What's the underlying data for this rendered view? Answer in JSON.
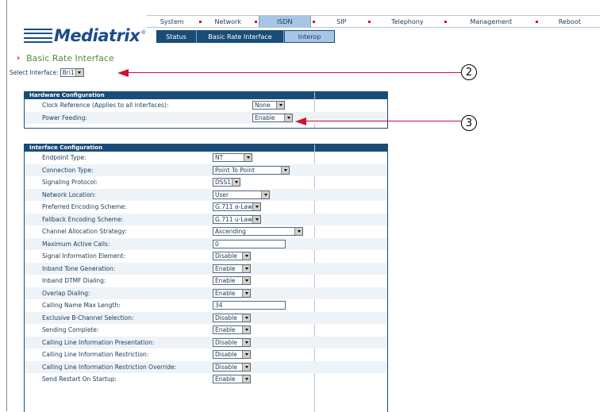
{
  "nav": {
    "items": [
      "System",
      "Network",
      "ISDN",
      "SIP",
      "Telephony",
      "Management",
      "Reboot"
    ],
    "active": "ISDN"
  },
  "subnav": {
    "items": [
      "Status",
      "Basic Rate Interface",
      "Interop"
    ],
    "active": "Interop"
  },
  "logo": {
    "text": "Mediatrix",
    "reg": "®"
  },
  "page_title": "Basic Rate Interface",
  "select_interface": {
    "label": "Select Interface:",
    "value": "Bri1"
  },
  "hardware": {
    "header": "Hardware Configuration",
    "rows": [
      {
        "label": "Clock Reference (Applies to all interfaces):",
        "value": "None"
      },
      {
        "label": "Power Feeding:",
        "value": "Enable"
      }
    ]
  },
  "interface": {
    "header": "Interface Configuration",
    "rows": [
      {
        "label": "Endpoint Type:",
        "value": "NT",
        "kind": "select"
      },
      {
        "label": "Connection Type:",
        "value": "Point To Point",
        "kind": "select"
      },
      {
        "label": "Signaling Protocol:",
        "value": "DSS1",
        "kind": "select"
      },
      {
        "label": "Network Location:",
        "value": "User",
        "kind": "select"
      },
      {
        "label": "Preferred Encoding Scheme:",
        "value": "G.711 a-Law",
        "kind": "select"
      },
      {
        "label": "Fallback Encoding Scheme:",
        "value": "G.711 u-Law",
        "kind": "select"
      },
      {
        "label": "Channel Allocation Strategy:",
        "value": "Ascending",
        "kind": "select"
      },
      {
        "label": "Maximum Active Calls:",
        "value": "0",
        "kind": "text"
      },
      {
        "label": "Signal Information Element:",
        "value": "Disable",
        "kind": "select"
      },
      {
        "label": "Inband Tone Generation:",
        "value": "Enable",
        "kind": "select"
      },
      {
        "label": "Inband DTMF Dialing:",
        "value": "Enable",
        "kind": "select"
      },
      {
        "label": "Overlap Dialing:",
        "value": "Enable",
        "kind": "select"
      },
      {
        "label": "Calling Name Max Length:",
        "value": "34",
        "kind": "text"
      },
      {
        "label": "Exclusive B-Channel Selection:",
        "value": "Disable",
        "kind": "select"
      },
      {
        "label": "Sending Complete:",
        "value": "Enable",
        "kind": "select"
      },
      {
        "label": "Calling Line Information Presentation:",
        "value": "Disable",
        "kind": "select"
      },
      {
        "label": "Calling Line Information Restriction:",
        "value": "Disable",
        "kind": "select"
      },
      {
        "label": "Calling Line Information Restriction Override:",
        "value": "Disable",
        "kind": "select"
      },
      {
        "label": "Send Restart On Startup:",
        "value": "Enable",
        "kind": "select"
      }
    ]
  },
  "callouts": [
    "2",
    "3"
  ],
  "colors": {
    "brand": "#1a4c8c",
    "header": "#1a4c78",
    "active_tab": "#a7c5e6",
    "accent": "#cc1133",
    "title": "#4f8f3a"
  }
}
